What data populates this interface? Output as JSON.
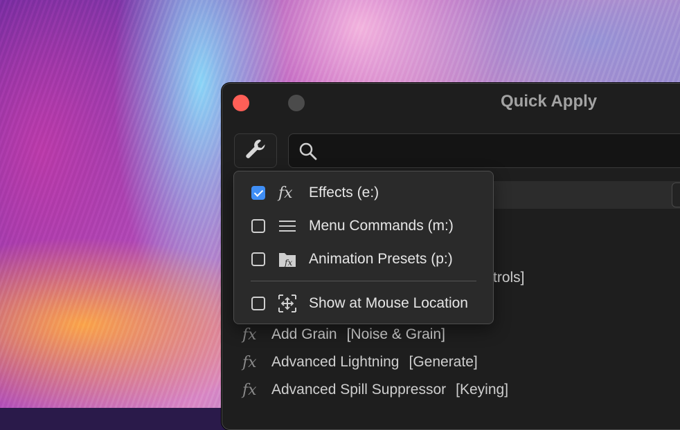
{
  "window": {
    "title": "Quick Apply"
  },
  "search": {
    "value": "",
    "placeholder": ""
  },
  "menu": {
    "items": [
      {
        "label": "Effects (e:)",
        "checked": true,
        "icon": "fx-icon"
      },
      {
        "label": "Menu Commands (m:)",
        "checked": false,
        "icon": "menu-lines-icon"
      },
      {
        "label": "Animation Presets (p:)",
        "checked": false,
        "icon": "preset-folder-icon"
      },
      {
        "label": "Show at Mouse Location",
        "checked": false,
        "icon": "move-arrows-icon"
      }
    ]
  },
  "results": {
    "partial_text": "trols]",
    "items": [
      {
        "fx": "fx",
        "name": "Add Grain",
        "category": "[Noise & Grain]"
      },
      {
        "fx": "fx",
        "name": "Advanced Lightning",
        "category": "[Generate]"
      },
      {
        "fx": "fx",
        "name": "Advanced Spill Suppressor",
        "category": "[Keying]"
      }
    ]
  },
  "colors": {
    "close": "#ff5f57",
    "checkbox_checked": "#3f8ef5",
    "window_bg": "#1e1e1e",
    "menu_bg": "#2a2a2a"
  }
}
